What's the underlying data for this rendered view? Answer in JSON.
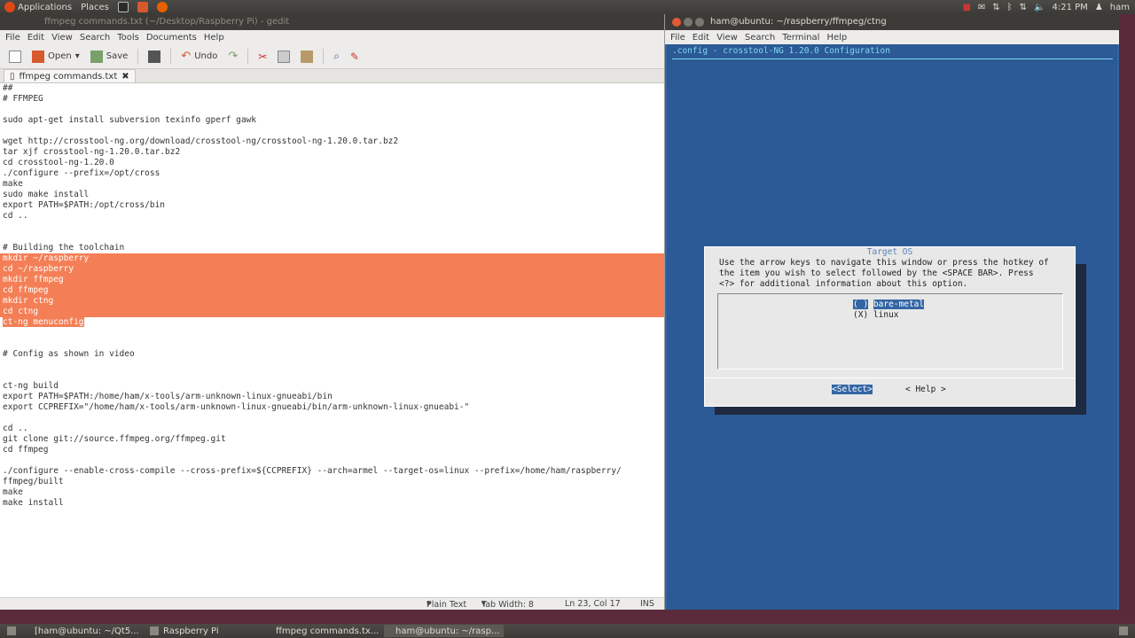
{
  "top_panel": {
    "applications": "Applications",
    "places": "Places",
    "time": "4:21 PM",
    "user": "ham"
  },
  "gedit": {
    "title": "ffmpeg commands.txt (~/Desktop/Raspberry Pi) - gedit",
    "menu": [
      "File",
      "Edit",
      "View",
      "Search",
      "Tools",
      "Documents",
      "Help"
    ],
    "toolbar": {
      "open": "Open",
      "save": "Save",
      "undo": "Undo"
    },
    "tab_label": "ffmpeg commands.txt",
    "lines": [
      "##",
      "# FFMPEG",
      "",
      "sudo apt-get install subversion texinfo gperf gawk",
      "",
      "wget http://crosstool-ng.org/download/crosstool-ng/crosstool-ng-1.20.0.tar.bz2",
      "tar xjf crosstool-ng-1.20.0.tar.bz2",
      "cd crosstool-ng-1.20.0",
      "./configure --prefix=/opt/cross",
      "make",
      "sudo make install",
      "export PATH=$PATH:/opt/cross/bin",
      "cd ..",
      "",
      "",
      "# Building the toolchain",
      "mkdir ~/raspberry",
      "cd ~/raspberry",
      "mkdir ffmpeg",
      "cd ffmpeg",
      "mkdir ctng",
      "cd ctng",
      "ct-ng menuconfig",
      "",
      "",
      "# Config as shown in video",
      "",
      "",
      "ct-ng build",
      "export PATH=$PATH:/home/ham/x-tools/arm-unknown-linux-gnueabi/bin",
      "export CCPREFIX=\"/home/ham/x-tools/arm-unknown-linux-gnueabi/bin/arm-unknown-linux-gnueabi-\"",
      "",
      "cd ..",
      "git clone git://source.ffmpeg.org/ffmpeg.git",
      "cd ffmpeg",
      "",
      "./configure --enable-cross-compile --cross-prefix=${CCPREFIX} --arch=armel --target-os=linux --prefix=/home/ham/raspberry/",
      "ffmpeg/built",
      "make",
      "make install"
    ],
    "status": {
      "mode": "Plain Text",
      "tab_width": "Tab Width: 8",
      "position": "Ln 23, Col 17",
      "ins": "INS"
    }
  },
  "terminal": {
    "title": "ham@ubuntu: ~/raspberry/ffmpeg/ctng",
    "menu": [
      "File",
      "Edit",
      "View",
      "Search",
      "Terminal",
      "Help"
    ],
    "header": ".config - crosstool-NG 1.20.0 Configuration",
    "dialog": {
      "title": "Target OS",
      "text": "Use the arrow keys to navigate this window or press the hotkey of\nthe item you wish to select followed by the <SPACE BAR>. Press\n<?> for additional information about this option.",
      "options": [
        {
          "mark": "( )",
          "label": "bare-metal",
          "selected": true
        },
        {
          "mark": "(X)",
          "label": "linux",
          "selected": false
        }
      ],
      "select_button": "<Select>",
      "help_button": "< Help >"
    }
  },
  "taskbar": {
    "items": [
      "[ham@ubuntu: ~/Qt5...",
      "Raspberry Pi",
      "ffmpeg commands.tx...",
      "ham@ubuntu: ~/rasp..."
    ]
  },
  "colors": {
    "selection": "#f47f56",
    "terminal_bg": "#2c5a96",
    "dialog_highlight": "#3466a4"
  }
}
